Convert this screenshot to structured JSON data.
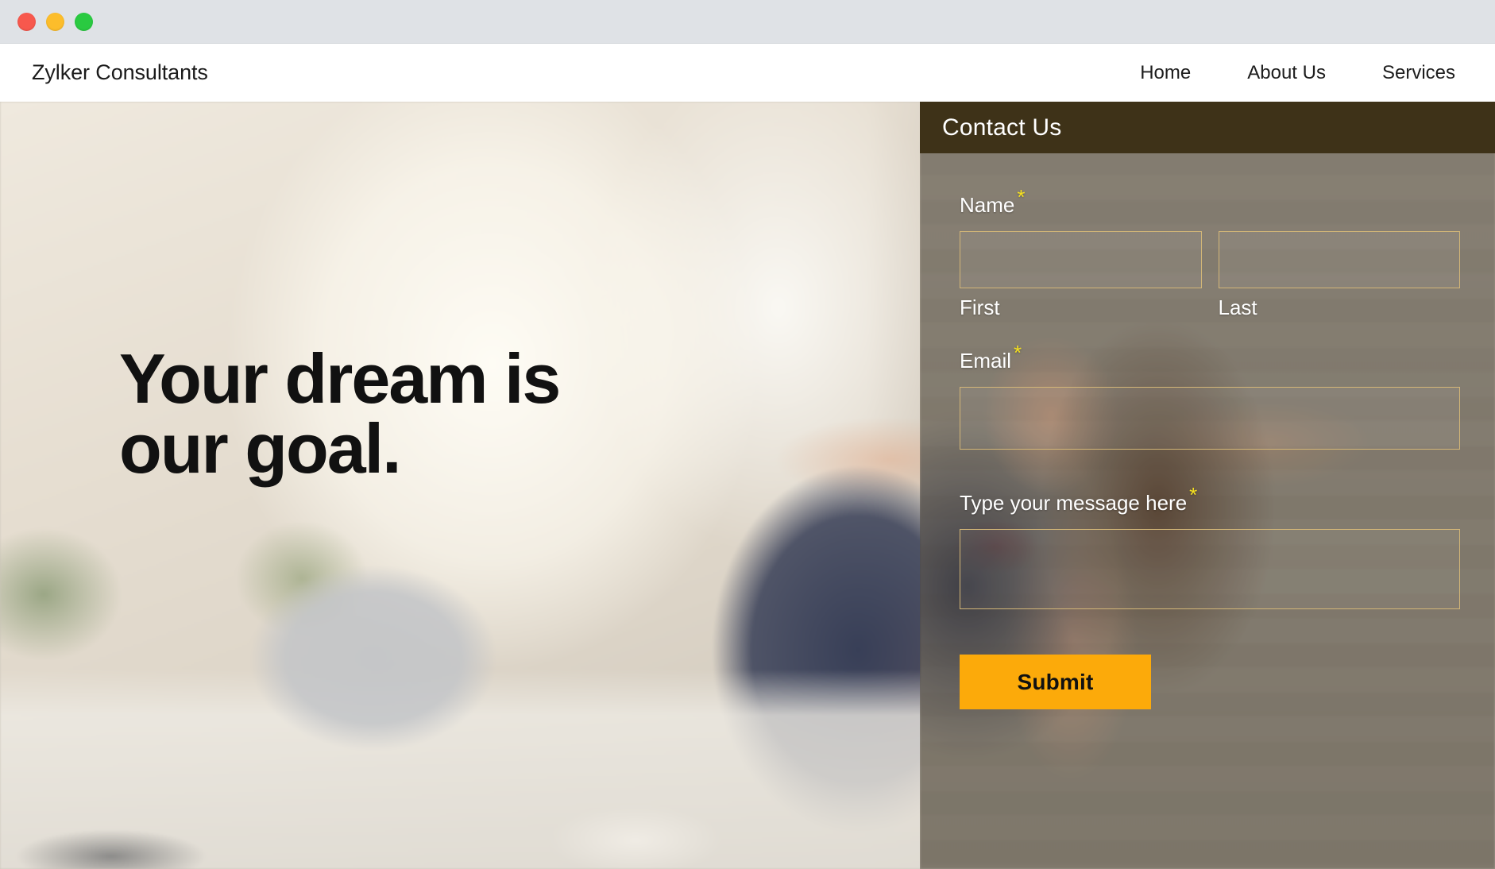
{
  "window": {
    "controls": [
      {
        "name": "close",
        "color": "#f7584d"
      },
      {
        "name": "minimize",
        "color": "#fcbd2b"
      },
      {
        "name": "maximize",
        "color": "#2aca41"
      }
    ]
  },
  "header": {
    "brand": "Zylker Consultants",
    "nav": [
      {
        "label": "Home"
      },
      {
        "label": "About Us"
      },
      {
        "label": "Services"
      }
    ]
  },
  "hero": {
    "headline": "Your dream is\nour goal."
  },
  "contact": {
    "title": "Contact Us",
    "required_marker": "*",
    "fields": {
      "name": {
        "label": "Name",
        "first": {
          "sub_label": "First",
          "value": "",
          "placeholder": ""
        },
        "last": {
          "sub_label": "Last",
          "value": "",
          "placeholder": ""
        }
      },
      "email": {
        "label": "Email",
        "value": "",
        "placeholder": ""
      },
      "message": {
        "label": "Type your message here",
        "value": "",
        "placeholder": ""
      }
    },
    "submit_label": "Submit",
    "colors": {
      "header_background": "#3e3218",
      "field_border": "#d3b677",
      "required_asterisk": "#f5e020",
      "submit_background": "#fcaa0a",
      "submit_text": "#111111"
    }
  }
}
